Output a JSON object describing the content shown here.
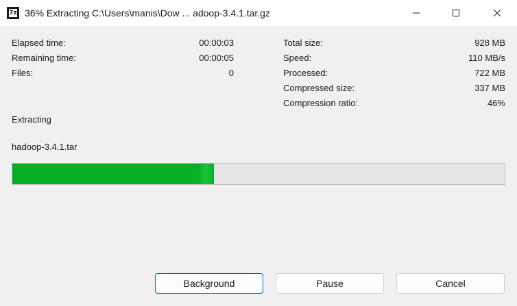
{
  "window": {
    "title": "36% Extracting C:\\Users\\manis\\Dow ... adoop-3.4.1.tar.gz",
    "app_icon_text": "7z"
  },
  "stats_left": [
    {
      "label": "Elapsed time:",
      "value": "00:00:03"
    },
    {
      "label": "Remaining time:",
      "value": "00:00:05"
    },
    {
      "label": "Files:",
      "value": "0"
    }
  ],
  "stats_right": [
    {
      "label": "Total size:",
      "value": "928 MB"
    },
    {
      "label": "Speed:",
      "value": "110 MB/s"
    },
    {
      "label": "Processed:",
      "value": "722 MB"
    },
    {
      "label": "Compressed size:",
      "value": "337 MB"
    },
    {
      "label": "Compression ratio:",
      "value": "46%"
    }
  ],
  "operation": "Extracting",
  "current_file": "hadoop-3.4.1.tar",
  "progress": {
    "fraction": 0.41,
    "fill_color": "#06b025"
  },
  "buttons": {
    "background": "Background",
    "pause": "Pause",
    "cancel": "Cancel"
  },
  "icons": {
    "minimize": "minimize-icon",
    "maximize": "maximize-icon",
    "close": "close-icon"
  }
}
